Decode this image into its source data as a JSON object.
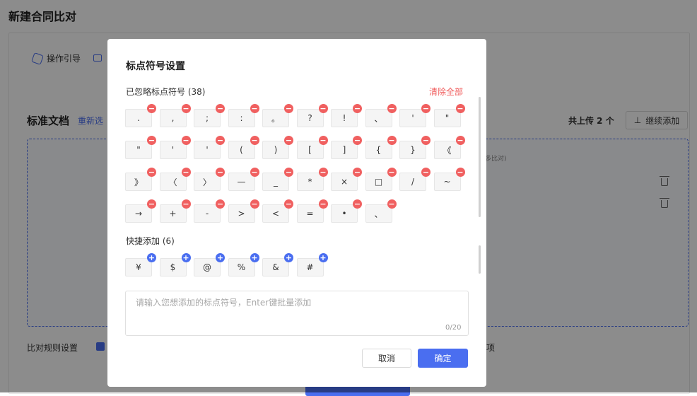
{
  "page": {
    "title": "新建合同比对"
  },
  "toolbar": {
    "guide_label": "操作引导",
    "guide_icon": "guide-icon",
    "video_icon": "video-icon"
  },
  "standard_doc": {
    "title": "标准文档",
    "reselect_label": "重新选",
    "uploaded_text": "共上传 2 个",
    "continue_add_label": "继续添加",
    "upload_icon": "upload-icon",
    "hint_text": "多比对)"
  },
  "rules": {
    "label": "比对规则设置",
    "option_suffix": "项"
  },
  "modal": {
    "title": "标点符号设置",
    "ignored_label": "已忽略标点符号 (38)",
    "clear_all_label": "清除全部",
    "ignored_symbols": [
      ".",
      ",",
      ";",
      ":",
      "。",
      "?",
      "!",
      "、",
      "'",
      "\"",
      "\"",
      "'",
      "'",
      "(",
      ")",
      "[",
      "]",
      "{",
      "}",
      "《",
      "》",
      "〈",
      "〉",
      "—",
      "_",
      "*",
      "×",
      "□",
      "/",
      "~",
      "→",
      "+",
      "-",
      ">",
      "<",
      "=",
      "•",
      "、"
    ],
    "quick_add_label": "快捷添加 (6)",
    "quick_symbols": [
      "¥",
      "$",
      "@",
      "%",
      "&",
      "#"
    ],
    "input": {
      "placeholder": "请输入您想添加的标点符号，Enter键批量添加",
      "value": "",
      "counter": "0/20"
    },
    "cancel_label": "取消",
    "ok_label": "确定",
    "remove_badge": "−",
    "add_badge": "+",
    "colors": {
      "accent": "#4a6ef0",
      "danger": "#f06060"
    }
  }
}
